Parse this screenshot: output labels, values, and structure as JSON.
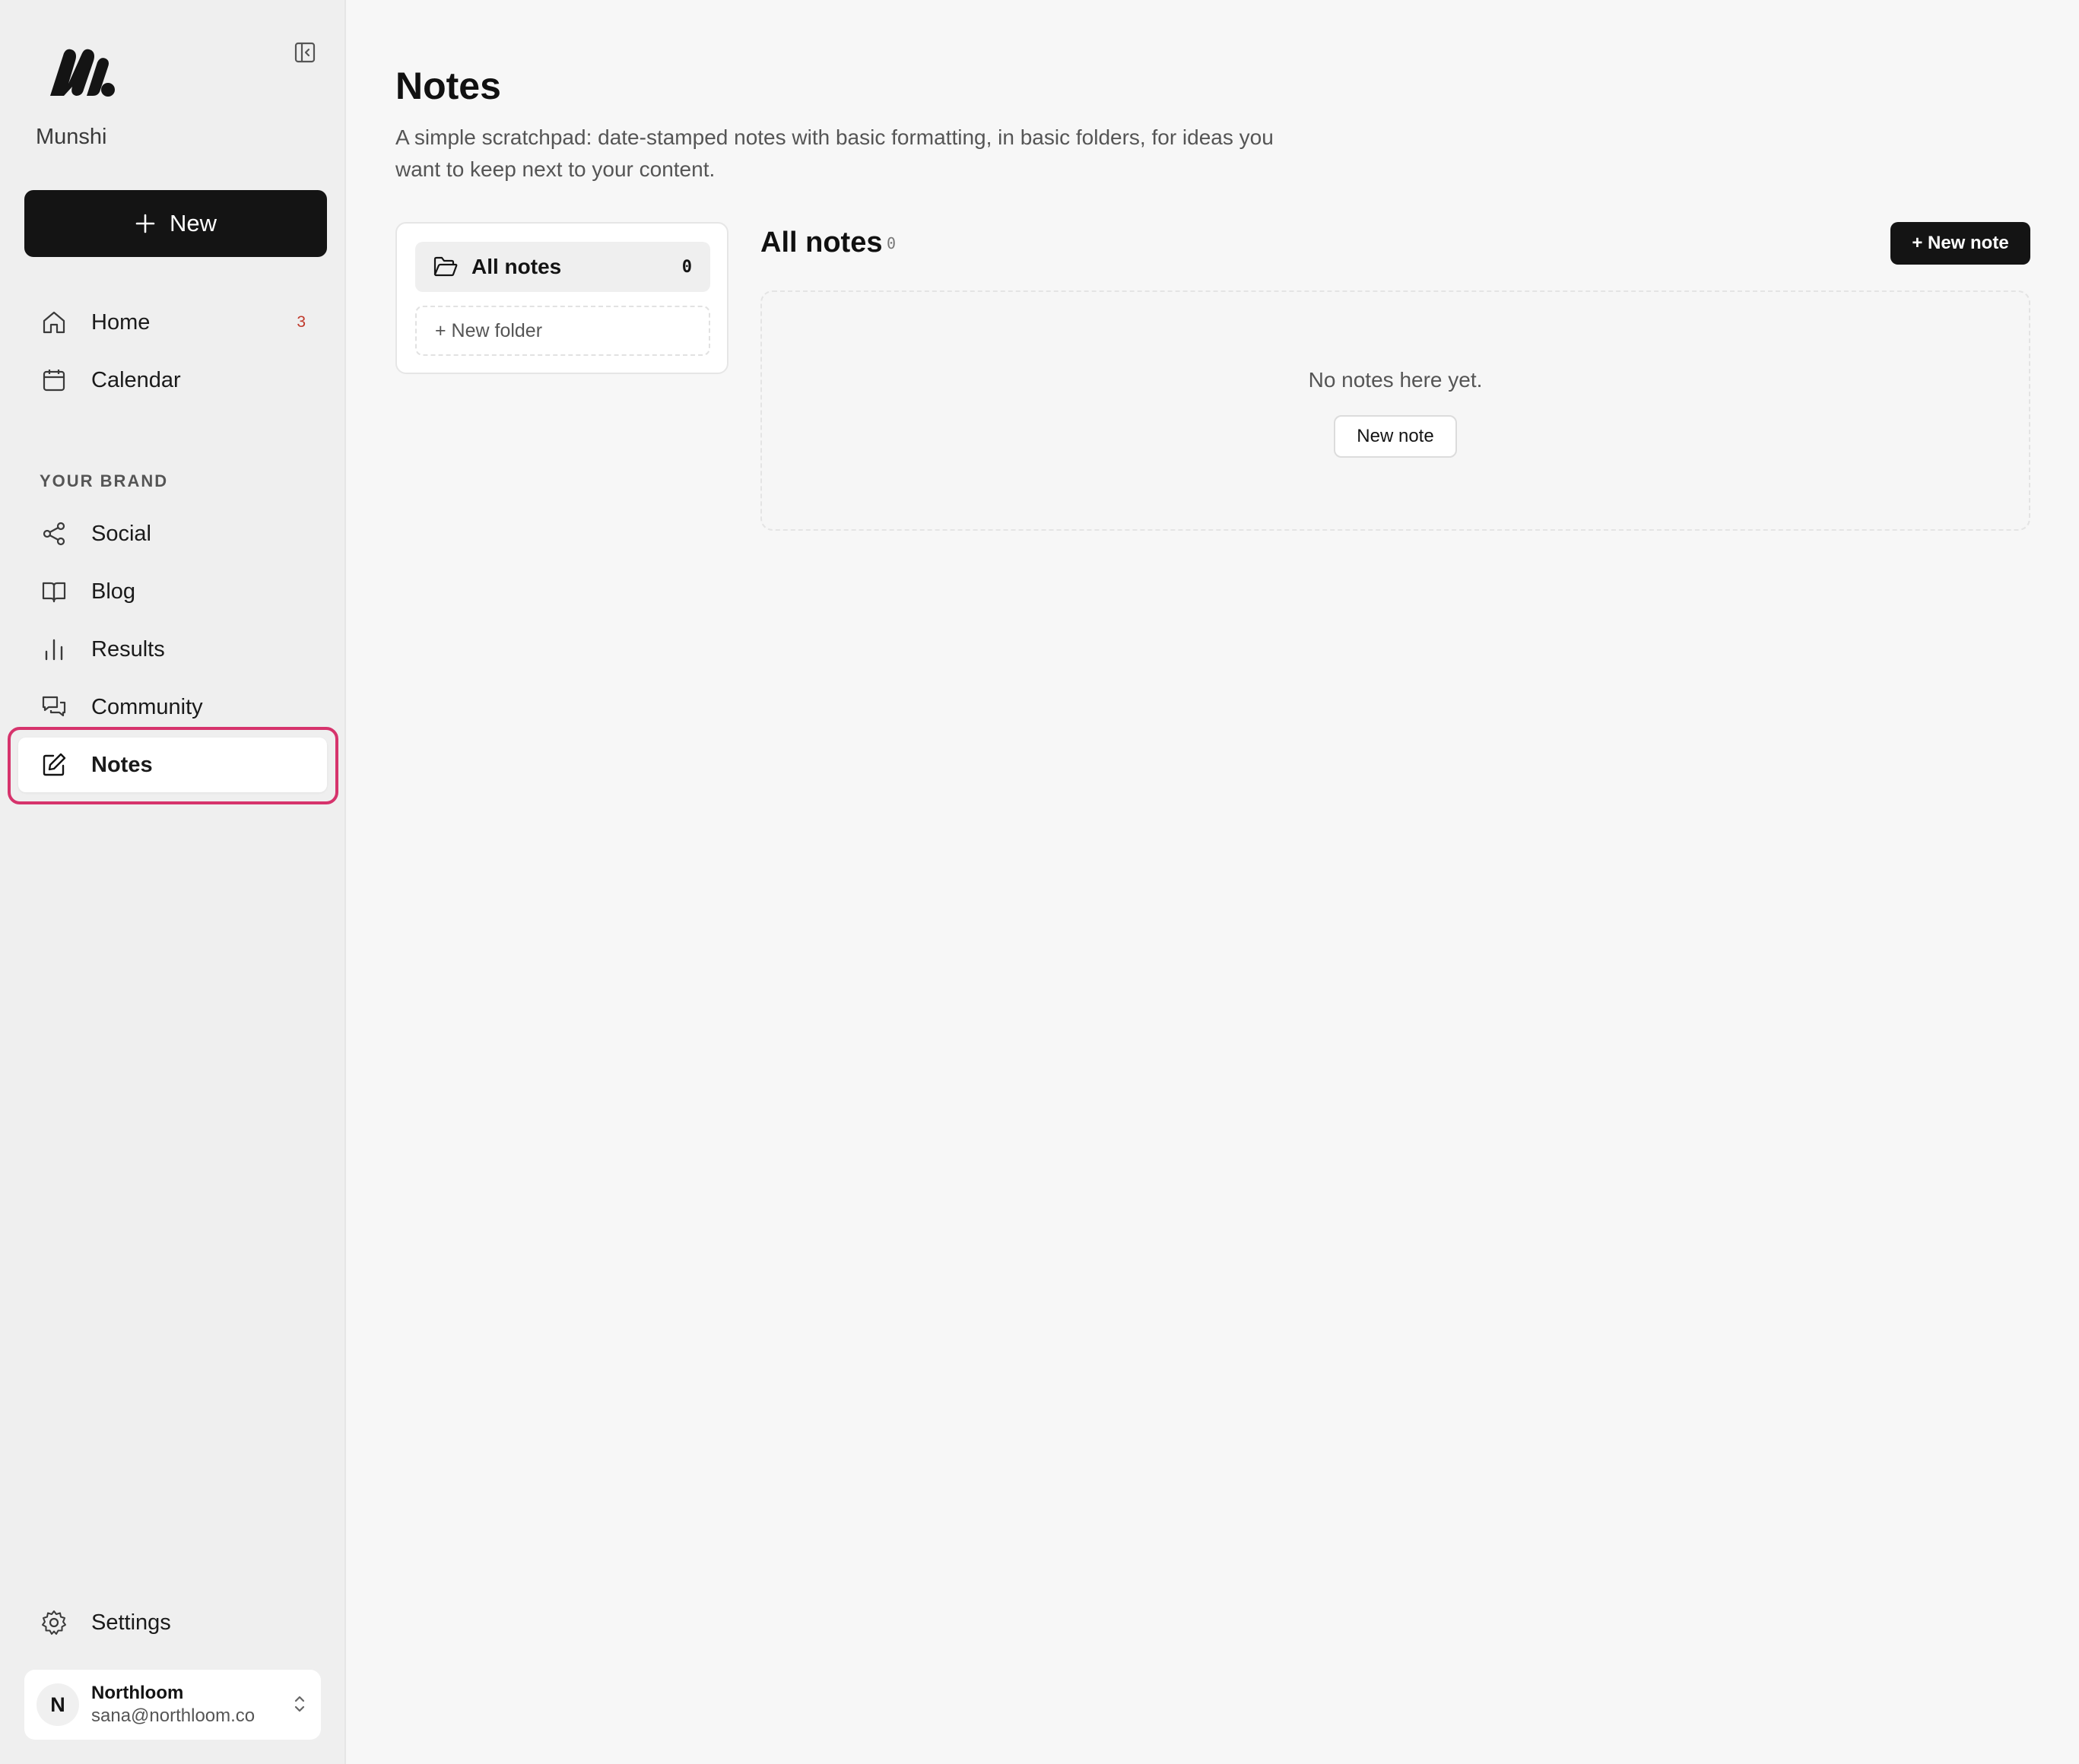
{
  "sidebar": {
    "brand_name": "Munshi",
    "new_button_label": "New",
    "nav_primary": [
      {
        "label": "Home",
        "badge": "3",
        "icon": "home-icon"
      },
      {
        "label": "Calendar",
        "icon": "calendar-icon"
      }
    ],
    "section_label": "YOUR BRAND",
    "nav_brand": [
      {
        "label": "Social",
        "icon": "share-icon"
      },
      {
        "label": "Blog",
        "icon": "book-icon"
      },
      {
        "label": "Results",
        "icon": "bar-chart-icon"
      },
      {
        "label": "Community",
        "icon": "chat-icon"
      },
      {
        "label": "Notes",
        "icon": "edit-icon",
        "active": true
      }
    ],
    "settings_label": "Settings",
    "account": {
      "initial": "N",
      "name": "Northloom",
      "email": "sana@northloom.co"
    }
  },
  "main": {
    "title": "Notes",
    "description": "A simple scratchpad: date-stamped notes with basic formatting, in basic folders, for ideas you want to keep next to your content.",
    "folders": {
      "all_label": "All notes",
      "all_count": "0",
      "new_folder_label": "+ New folder"
    },
    "list": {
      "title": "All notes",
      "count": "0",
      "new_note_button": "+ New note",
      "empty_text": "No notes here yet.",
      "empty_button": "New note"
    }
  },
  "colors": {
    "accent_dark": "#141414",
    "highlight": "#d6336c",
    "badge": "#c0392b"
  }
}
